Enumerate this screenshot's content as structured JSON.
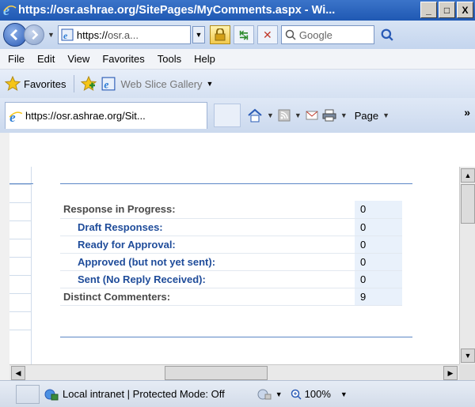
{
  "window": {
    "title": "https://osr.ashrae.org/SitePages/MyComments.aspx - Wi...",
    "controls": {
      "minimize": "_",
      "maximize": "□",
      "close": "X"
    }
  },
  "address": {
    "url_prefix": "https://",
    "url_rest": "osr.a...",
    "search_placeholder": "Google"
  },
  "menu": [
    "File",
    "Edit",
    "View",
    "Favorites",
    "Tools",
    "Help"
  ],
  "favorites": {
    "label": "Favorites",
    "web_slice": "Web Slice Gallery"
  },
  "tab": {
    "label": "https://osr.ashrae.org/Sit..."
  },
  "commandbar": {
    "page_label": "Page"
  },
  "stats": {
    "rows": [
      {
        "label": "Response in Progress:",
        "value": "0"
      },
      {
        "label": "Draft Responses:",
        "value": "0"
      },
      {
        "label": "Ready for Approval:",
        "value": "0"
      },
      {
        "label": "Approved (but not yet sent):",
        "value": "0"
      },
      {
        "label": "Sent (No Reply Received):",
        "value": "0"
      },
      {
        "label": "Distinct Commenters:",
        "value": "9"
      }
    ]
  },
  "status": {
    "zone": "Local intranet | Protected Mode: Off",
    "zoom": "100%"
  },
  "colors": {
    "titlebar": "#1f58b3",
    "link_blue": "#1f4c9a",
    "accent_line": "#5b87c6",
    "value_bg": "#e9f1fb"
  }
}
